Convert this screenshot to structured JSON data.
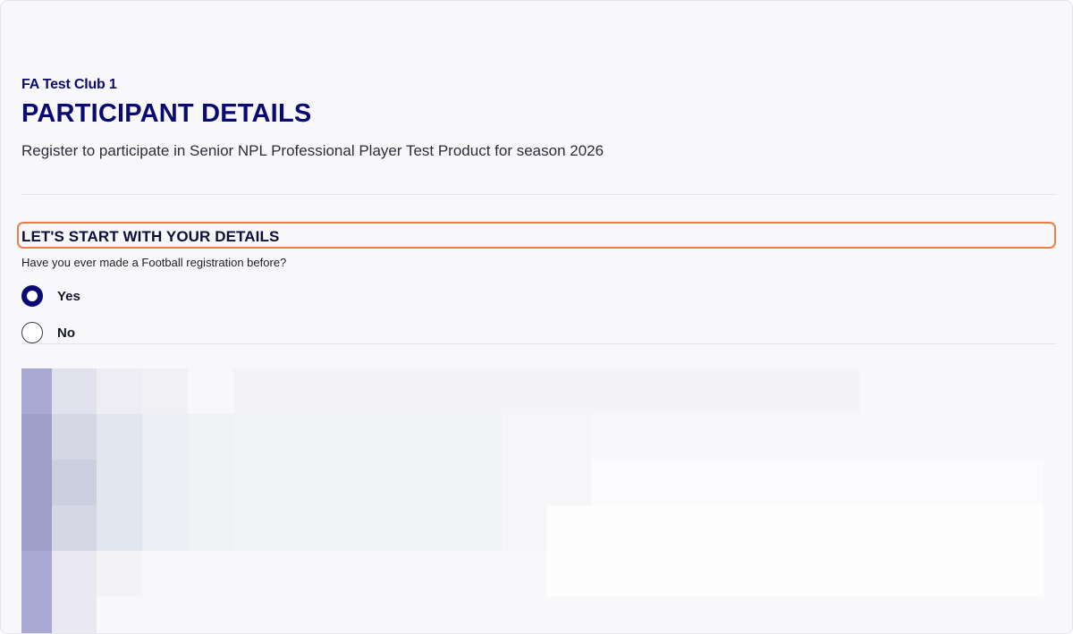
{
  "header": {
    "club_name": "FA Test Club 1",
    "title": "PARTICIPANT DETAILS",
    "subtitle": "Register to participate in Senior NPL Professional Player Test Product for season 2026"
  },
  "section": {
    "heading": "LET'S START WITH YOUR DETAILS",
    "question": "Have you ever made a Football registration before?",
    "options": [
      {
        "label": "Yes",
        "checked": true
      },
      {
        "label": "No",
        "checked": false
      }
    ]
  },
  "colors": {
    "brand_navy": "#0a0a73",
    "highlight": "#f07a4a",
    "background": "#f8f8fb"
  }
}
